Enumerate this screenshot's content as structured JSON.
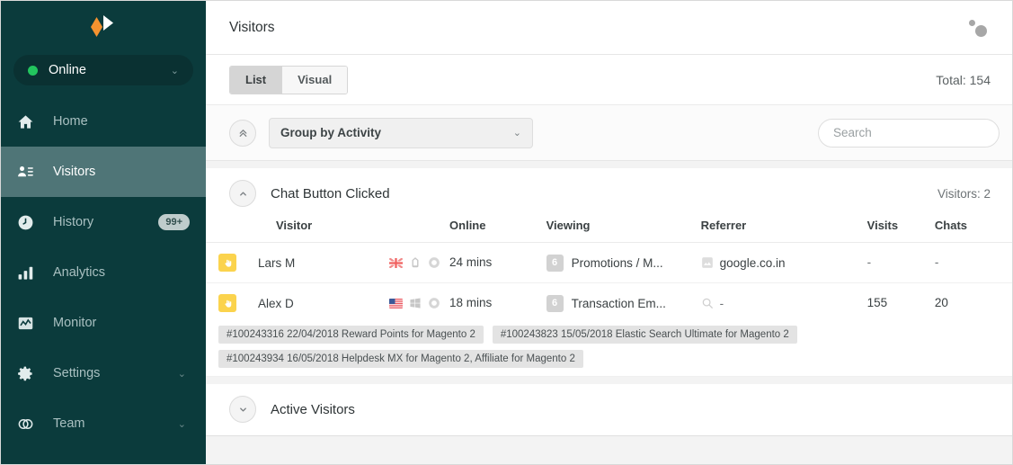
{
  "sidebar": {
    "logo": {
      "name": "app-logo"
    },
    "status": {
      "label": "Online",
      "dot_color": "#22c55e",
      "caret": "⌄"
    },
    "items": [
      {
        "label": "Home",
        "icon": "home-icon",
        "active": false,
        "badge": null,
        "caret": null
      },
      {
        "label": "Visitors",
        "icon": "visitors-icon",
        "active": true,
        "badge": null,
        "caret": null
      },
      {
        "label": "History",
        "icon": "clock-icon",
        "active": false,
        "badge": "99+",
        "caret": null
      },
      {
        "label": "Analytics",
        "icon": "bar-chart-icon",
        "active": false,
        "badge": null,
        "caret": null
      },
      {
        "label": "Monitor",
        "icon": "monitor-icon",
        "active": false,
        "badge": null,
        "caret": null
      },
      {
        "label": "Settings",
        "icon": "gear-icon",
        "active": false,
        "badge": null,
        "caret": "⌄"
      },
      {
        "label": "Team",
        "icon": "team-icon",
        "active": false,
        "badge": null,
        "caret": "⌄"
      }
    ],
    "colors": {
      "bg": "#0b3b3c",
      "active_bg": "#4f7577",
      "accent": "#f5922f"
    }
  },
  "topbar": {
    "title": "Visitors",
    "menu_icon": "two-dots-icon"
  },
  "subbar": {
    "tabs": [
      {
        "label": "List",
        "selected": true
      },
      {
        "label": "Visual",
        "selected": false
      }
    ],
    "total": "Total: 154"
  },
  "filterbar": {
    "collapse_icon": "double-chevron-up-icon",
    "group_by": {
      "value": "Group by Activity",
      "caret": "⌄"
    },
    "search": {
      "value": "",
      "placeholder": "Search"
    }
  },
  "sections": [
    {
      "title": "Chat Button Clicked",
      "count_label": "Visitors: 2",
      "expanded": true,
      "toggle_icon": "chevron-up-icon",
      "columns": [
        "Visitor",
        "Online",
        "Viewing",
        "Referrer",
        "Visits",
        "Chats"
      ],
      "rows": [
        {
          "activity_icon": "click-hand-icon",
          "name": "Lars M",
          "flag": "uk-flag-icon",
          "browser_icon": "browser-icon",
          "os_icon": "os-icon",
          "online": "24 mins",
          "viewing_count": "6",
          "viewing": "Promotions / M...",
          "referrer_icon": "site-favicon-icon",
          "referrer": "google.co.in",
          "visits": "-",
          "chats": "-",
          "tags": []
        },
        {
          "activity_icon": "click-hand-icon",
          "name": "Alex D",
          "flag": "us-flag-icon",
          "browser_icon": "windows-icon",
          "os_icon": "os-icon",
          "online": "18 mins",
          "viewing_count": "6",
          "viewing": "Transaction Em...",
          "referrer_icon": "search-icon",
          "referrer": "-",
          "visits": "155",
          "chats": "20",
          "tags": [
            "#100243316 22/04/2018 Reward Points for Magento 2",
            "#100243823 15/05/2018 Elastic Search Ultimate for Magento 2",
            "#100243934 16/05/2018 Helpdesk MX for Magento 2, Affiliate for Magento 2"
          ]
        }
      ]
    },
    {
      "title": "Active Visitors",
      "count_label": "",
      "expanded": false,
      "toggle_icon": "chevron-down-icon",
      "columns": [],
      "rows": []
    }
  ]
}
